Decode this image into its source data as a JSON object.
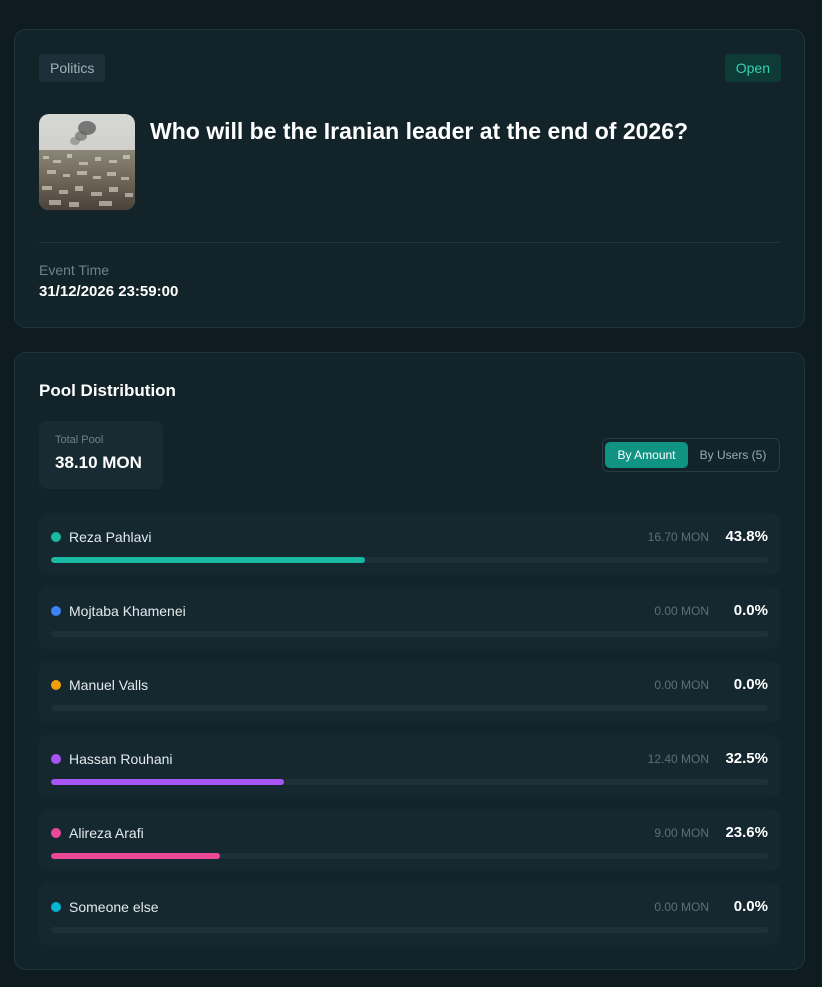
{
  "event": {
    "category": "Politics",
    "status": "Open",
    "title": "Who will be the Iranian leader at the end of 2026?",
    "time_label": "Event Time",
    "time_value": "31/12/2026 23:59:00"
  },
  "pool": {
    "title": "Pool Distribution",
    "total_label": "Total Pool",
    "total_value": "38.10 MON",
    "toggle": {
      "by_amount": "By Amount",
      "by_users": "By Users (5)",
      "selected": "By Amount"
    },
    "outcomes": [
      {
        "name": "Reza Pahlavi",
        "amount": "16.70 MON",
        "percent": "43.8%",
        "share": 0.438,
        "color": "#1ab8a0"
      },
      {
        "name": "Mojtaba Khamenei",
        "amount": "0.00 MON",
        "percent": "0.0%",
        "share": 0,
        "color": "#3b82f6"
      },
      {
        "name": "Manuel Valls",
        "amount": "0.00 MON",
        "percent": "0.0%",
        "share": 0,
        "color": "#f59e0b"
      },
      {
        "name": "Hassan Rouhani",
        "amount": "12.40 MON",
        "percent": "32.5%",
        "share": 0.325,
        "color": "#a855f7"
      },
      {
        "name": "Alireza Arafi",
        "amount": "9.00 MON",
        "percent": "23.6%",
        "share": 0.236,
        "color": "#ec4899"
      },
      {
        "name": "Someone else",
        "amount": "0.00 MON",
        "percent": "0.0%",
        "share": 0,
        "color": "#06b6d4"
      }
    ]
  }
}
